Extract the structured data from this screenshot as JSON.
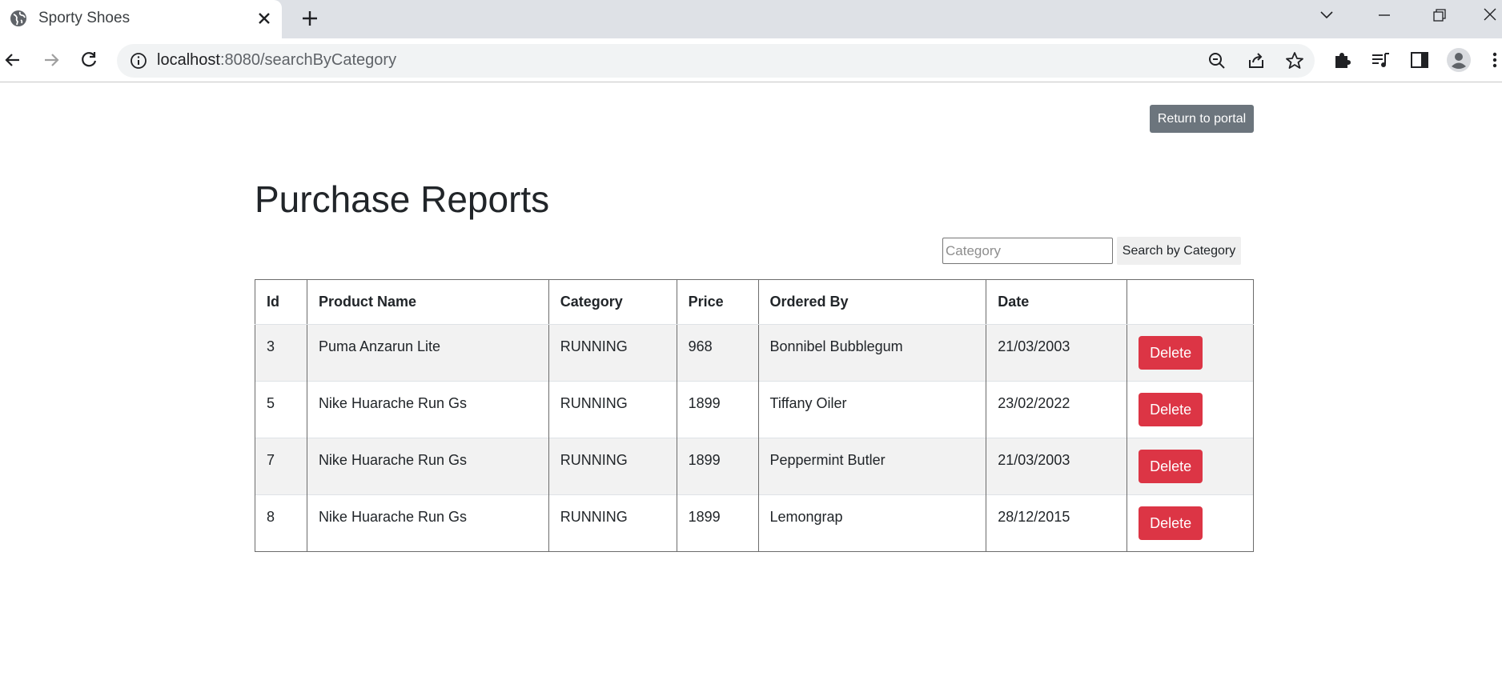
{
  "browser": {
    "tab": {
      "title": "Sporty Shoes",
      "favicon": "globe-icon"
    },
    "url": {
      "host": "localhost",
      "path": ":8080/searchByCategory"
    }
  },
  "page": {
    "return_button": "Return to portal",
    "title": "Purchase Reports",
    "search": {
      "placeholder": "Category",
      "value": "",
      "button": "Search by Category"
    }
  },
  "table": {
    "columns": [
      "Id",
      "Product Name",
      "Category",
      "Price",
      "Ordered By",
      "Date",
      ""
    ],
    "rows": [
      {
        "id": "3",
        "product": "Puma Anzarun Lite",
        "category": "RUNNING",
        "price": "968",
        "ordered_by": "Bonnibel Bubblegum",
        "date": "21/03/2003",
        "action": "Delete"
      },
      {
        "id": "5",
        "product": "Nike Huarache Run Gs",
        "category": "RUNNING",
        "price": "1899",
        "ordered_by": "Tiffany Oiler",
        "date": "23/02/2022",
        "action": "Delete"
      },
      {
        "id": "7",
        "product": "Nike Huarache Run Gs",
        "category": "RUNNING",
        "price": "1899",
        "ordered_by": "Peppermint Butler",
        "date": "21/03/2003",
        "action": "Delete"
      },
      {
        "id": "8",
        "product": "Nike Huarache Run Gs",
        "category": "RUNNING",
        "price": "1899",
        "ordered_by": "Lemongrap",
        "date": "28/12/2015",
        "action": "Delete"
      }
    ]
  },
  "colors": {
    "danger": "#dc3545",
    "secondary": "#6c757d",
    "stripe": "#f2f2f2"
  }
}
